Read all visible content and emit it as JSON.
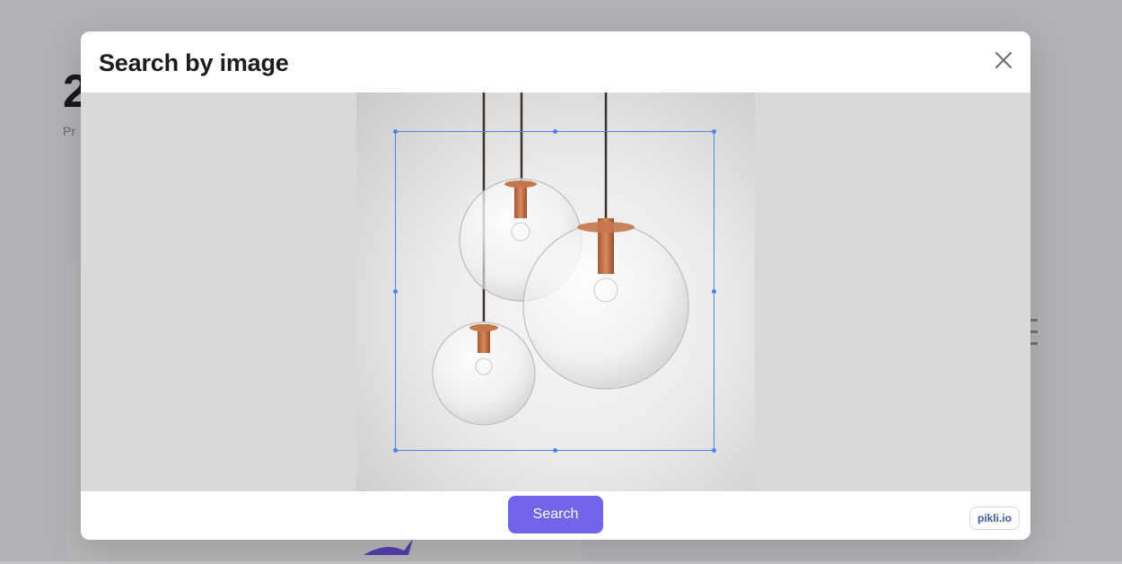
{
  "modal": {
    "title": "Search by image",
    "close_icon": "close-icon",
    "search_button_label": "Search",
    "brand_badge": "pikli.io"
  },
  "image": {
    "subject": "three-glass-globe-pendant-lamps",
    "icon": "image-photo"
  },
  "colors": {
    "accent": "#7165ea",
    "crop_border": "#4d84e8",
    "overlay": "#d9d9d9",
    "title": "#1c1c1f"
  }
}
